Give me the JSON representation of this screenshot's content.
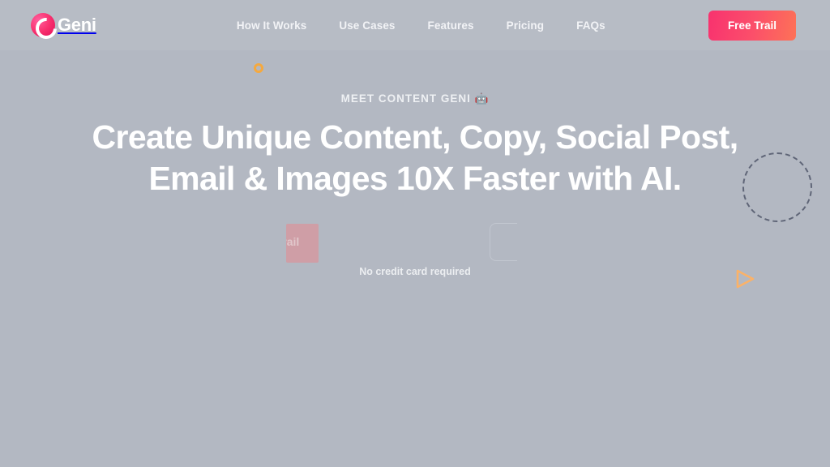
{
  "theme": {
    "page_background": "#b3b8c2",
    "header_background": "#b7bcc5",
    "brand_pink": "#f9316f",
    "brand_orange": "#fd7257",
    "accent_orange": "#f5a93f",
    "deco_outline": "#5f6577",
    "text_white": "#ffffff"
  },
  "header": {
    "brand": {
      "mark_icon": "geni-c-mark-icon",
      "name": "Geni"
    },
    "nav": [
      {
        "label": "How It Works"
      },
      {
        "label": "Use Cases"
      },
      {
        "label": "Features"
      },
      {
        "label": "Pricing"
      },
      {
        "label": "FAQs"
      }
    ],
    "cta": {
      "label": "Free Trail"
    }
  },
  "hero": {
    "eyebrow": "MEET CONTENT GENI 🤖",
    "title_line_1": "Create Unique Content, Copy, Social Post,",
    "title_line_2": "Email & Images 10X Faster with AI.",
    "cta_primary_label": "Free Trail",
    "cta_secondary_label": "",
    "note": "No credit card required"
  },
  "decorations": [
    {
      "name": "orange-ring-dot",
      "icon": "circle-outline-icon",
      "color": "#f5a93f"
    },
    {
      "name": "dashed-circle",
      "icon": "dashed-circle-icon",
      "color": "#5f6577"
    },
    {
      "name": "play-triangle",
      "icon": "play-triangle-icon",
      "color": "#fbb268"
    }
  ]
}
